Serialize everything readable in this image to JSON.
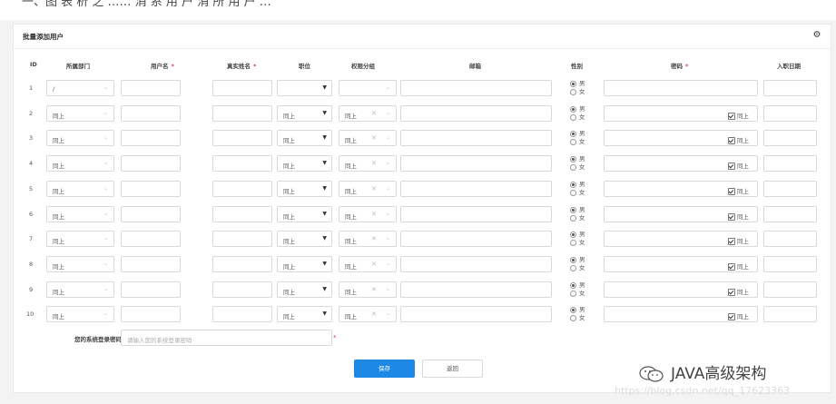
{
  "header": {
    "cut_text": "一、图 表 析 之 …… 消 系 用 户 消 所 用 户 …",
    "panel_title": "批量添加用户"
  },
  "columns": {
    "id": "ID",
    "dept": "所属部门",
    "username": "用户名",
    "realname": "真实姓名",
    "position": "职位",
    "group": "权限分组",
    "email": "邮箱",
    "gender": "性别",
    "password": "密码",
    "joindate": "入职日期",
    "required_mark": "*"
  },
  "rows": [
    {
      "id": "1",
      "dept": "/",
      "position": "",
      "group": "",
      "same_pw": false
    },
    {
      "id": "2",
      "dept": "同上",
      "position": "同上",
      "group": "同上",
      "same_pw": true
    },
    {
      "id": "3",
      "dept": "同上",
      "position": "同上",
      "group": "同上",
      "same_pw": true
    },
    {
      "id": "4",
      "dept": "同上",
      "position": "同上",
      "group": "同上",
      "same_pw": true
    },
    {
      "id": "5",
      "dept": "同上",
      "position": "同上",
      "group": "同上",
      "same_pw": true
    },
    {
      "id": "6",
      "dept": "同上",
      "position": "同上",
      "group": "同上",
      "same_pw": true
    },
    {
      "id": "7",
      "dept": "同上",
      "position": "同上",
      "group": "同上",
      "same_pw": true
    },
    {
      "id": "8",
      "dept": "同上",
      "position": "同上",
      "group": "同上",
      "same_pw": true
    },
    {
      "id": "9",
      "dept": "同上",
      "position": "同上",
      "group": "同上",
      "same_pw": true
    },
    {
      "id": "10",
      "dept": "同上",
      "position": "同上",
      "group": "同上",
      "same_pw": true
    }
  ],
  "gender_options": {
    "male": "男",
    "female": "女"
  },
  "same_label": "同上",
  "clear_glyph": "✕",
  "password_confirm": {
    "label": "您的系统登录密码",
    "placeholder": "请输入您的系统登录密码",
    "required_mark": "*"
  },
  "buttons": {
    "save": "保存",
    "back": "返回"
  },
  "watermark": {
    "brand": "JAVA高级架构",
    "url": "https://blog.csdn.net/qq_17623363"
  },
  "colors": {
    "primary": "#1e88e5",
    "required": "#e4393c",
    "border": "#d9d9d9"
  }
}
